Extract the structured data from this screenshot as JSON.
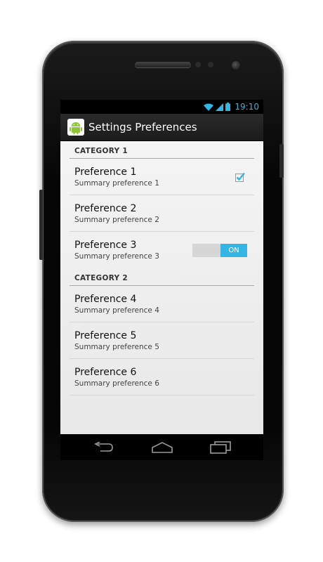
{
  "statusbar": {
    "time": "19:10",
    "icons": [
      "wifi-icon",
      "signal-icon",
      "battery-icon"
    ]
  },
  "actionbar": {
    "title": "Settings Preferences",
    "icon": "android-icon"
  },
  "categories": [
    {
      "label": "CATEGORY 1",
      "items": [
        {
          "title": "Preference 1",
          "summary": "Summary preference 1",
          "widget": "checkbox",
          "checked": true
        },
        {
          "title": "Preference 2",
          "summary": "Summary preference 2",
          "widget": "none"
        },
        {
          "title": "Preference 3",
          "summary": "Summary preference 3",
          "widget": "switch",
          "switch_label": "ON",
          "on": true
        }
      ]
    },
    {
      "label": "CATEGORY 2",
      "items": [
        {
          "title": "Preference 4",
          "summary": "Summary preference 4",
          "widget": "none"
        },
        {
          "title": "Preference 5",
          "summary": "Summary preference 5",
          "widget": "none"
        },
        {
          "title": "Preference 6",
          "summary": "Summary preference 6",
          "widget": "none"
        }
      ]
    }
  ],
  "navbar": {
    "buttons": [
      "back-icon",
      "home-icon",
      "recent-apps-icon"
    ]
  },
  "colors": {
    "accent": "#33b5e5",
    "actionbar_bg": "#222222",
    "content_bg": "#f2f2f2"
  }
}
